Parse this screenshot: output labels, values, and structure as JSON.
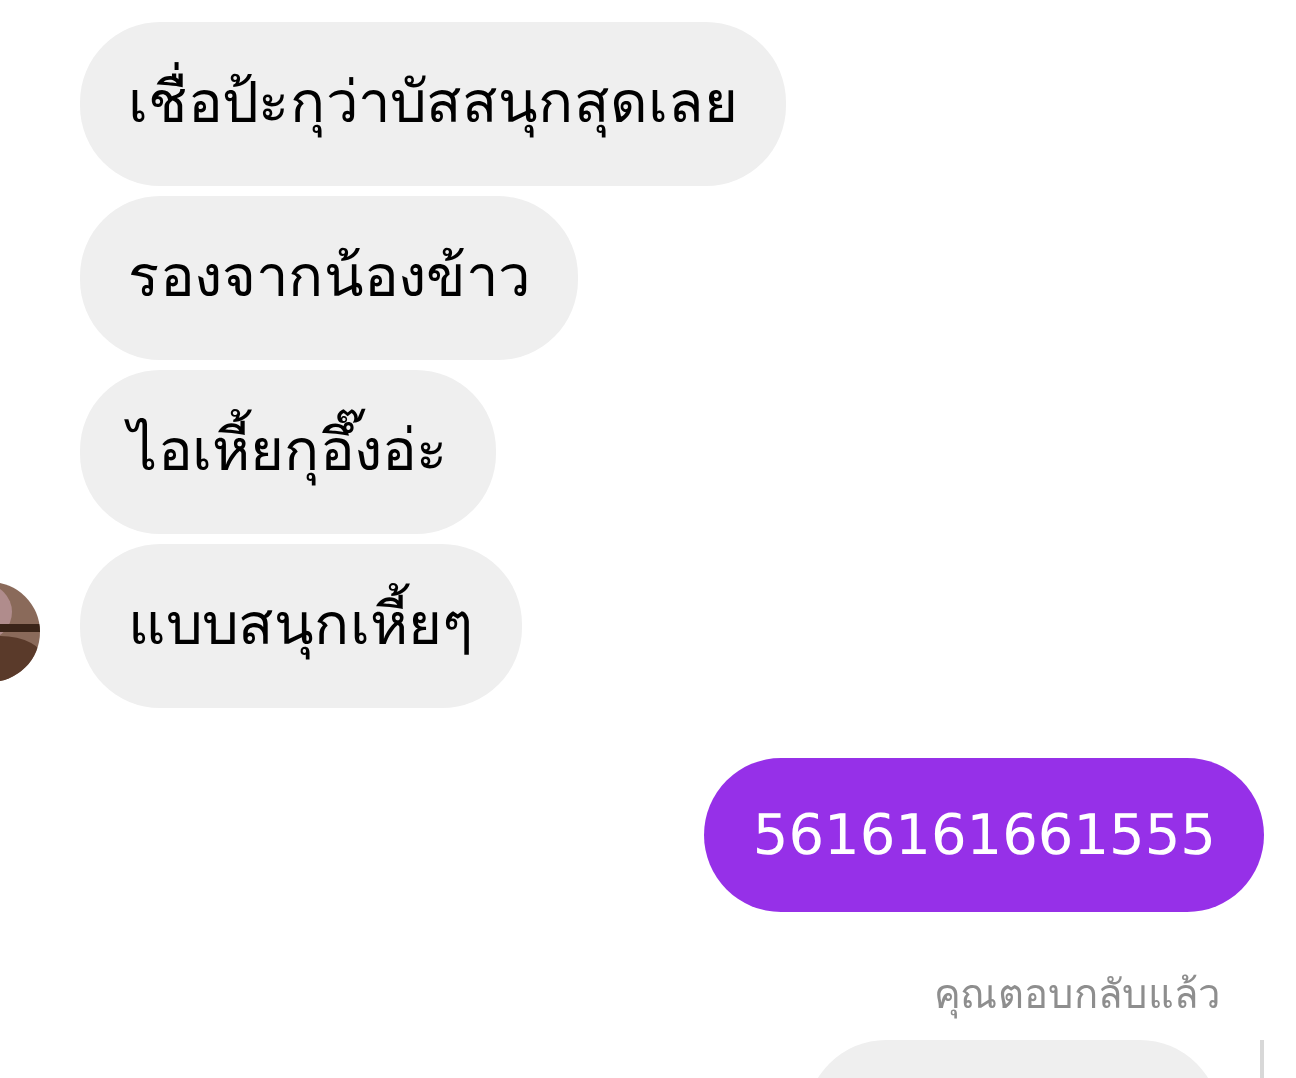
{
  "received": [
    {
      "text": "เชื่อป้ะกุว่าบัสสนุกสุดเลย"
    },
    {
      "text": "รองจากน้องข้าว"
    },
    {
      "text": "ไอเหี้ยกุอึ๊งอ่ะ"
    },
    {
      "text": "แบบสนุกเหี้ยๆ"
    }
  ],
  "sent": [
    {
      "text": "5616161661555"
    }
  ],
  "reply_status": "คุณตอบกลับแล้ว",
  "replied_message": {
    "kind": "quote"
  }
}
